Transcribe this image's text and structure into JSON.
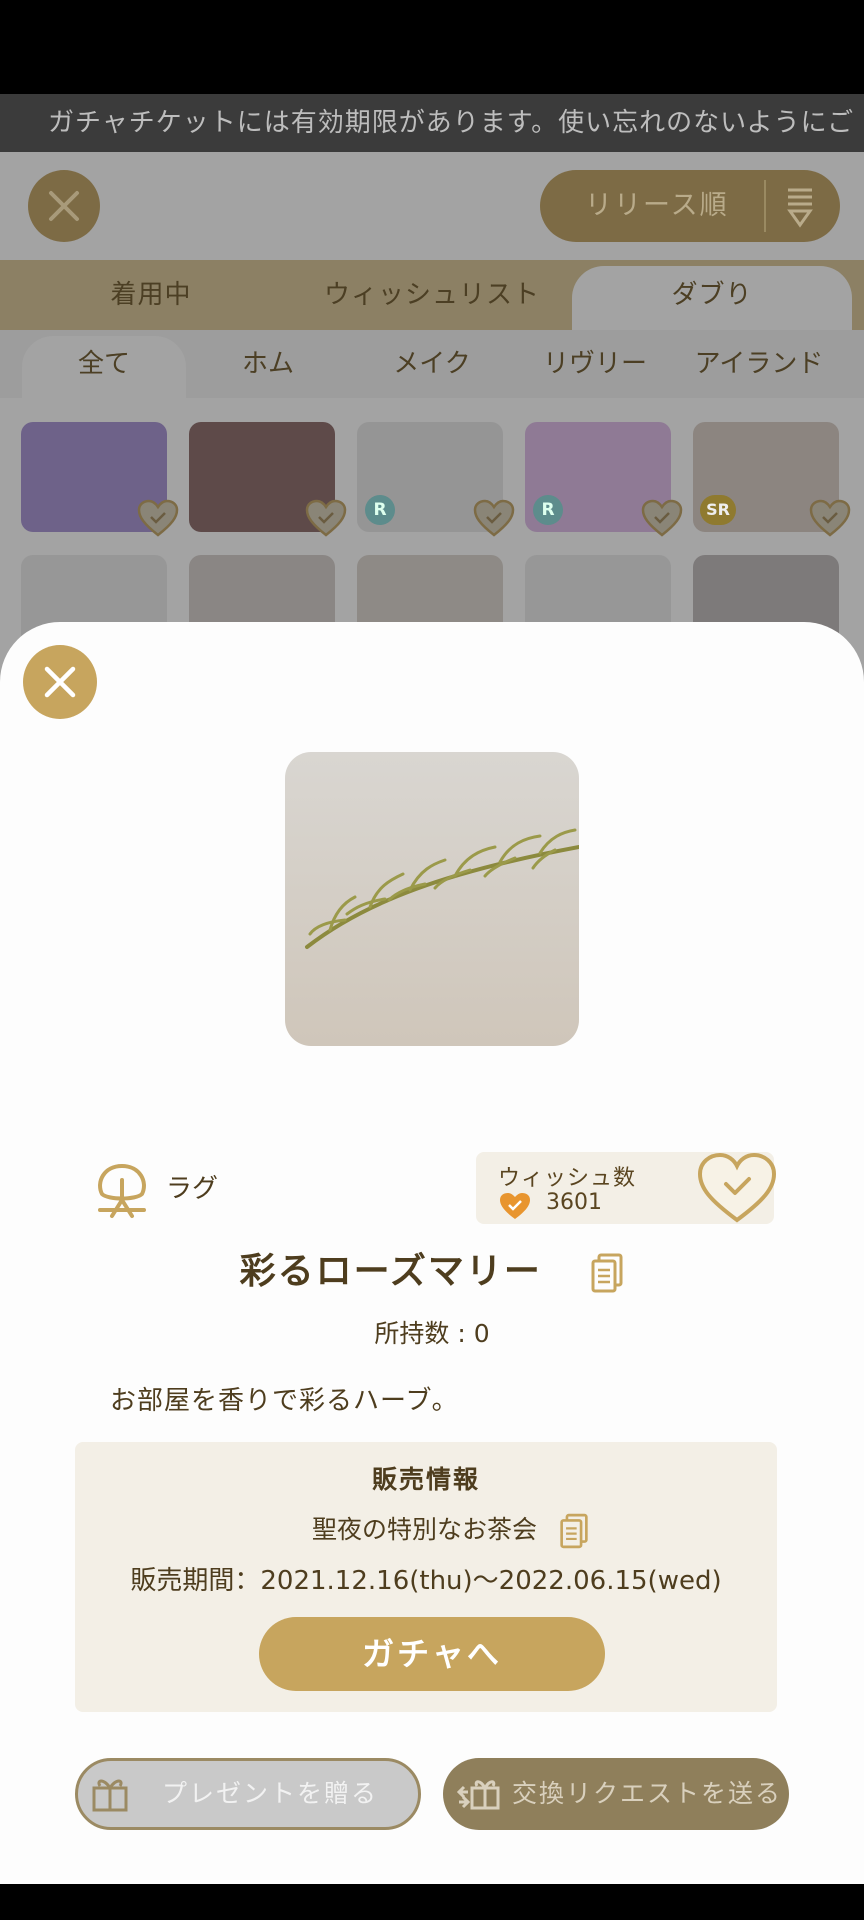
{
  "background": {
    "ticker_text": "ガチャチケットには有効期限があります。使い忘れのないようにご",
    "sort_label": "リリース順",
    "tabs": [
      "着用中",
      "ウィッシュリスト",
      "ダブり"
    ],
    "active_tab": "ダブり",
    "subtabs": [
      "全て",
      "ホム",
      "メイク",
      "リヴリー",
      "アイランド"
    ],
    "active_subtab": "全て",
    "rarity_badges": [
      "R",
      "R",
      "SR"
    ]
  },
  "item": {
    "category": "ラグ",
    "wish_label": "ウィッシュ数",
    "wish_count": "3601",
    "name": "彩るローズマリー",
    "owned": "所持数 : 0",
    "description": "お部屋を香りで彩るハーブ。"
  },
  "sale": {
    "heading": "販売情報",
    "event_name": "聖夜の特別なお茶会",
    "period": "販売期間：2021.12.16(thu)〜2022.06.15(wed)",
    "gacha_button": "ガチャへ"
  },
  "actions": {
    "gift_label": "プレゼントを贈る",
    "trade_label": "交換リクエストを送る"
  },
  "colors": {
    "accent_gold": "#c7a55e",
    "text_brown": "#4e3d1e",
    "panel_beige": "#f3efe6",
    "heart_orange": "#e8952f"
  },
  "icons": [
    "close-icon",
    "sort-icon",
    "rug-icon",
    "heart-check-icon",
    "document-icon",
    "gift-icon",
    "exchange-icon"
  ]
}
